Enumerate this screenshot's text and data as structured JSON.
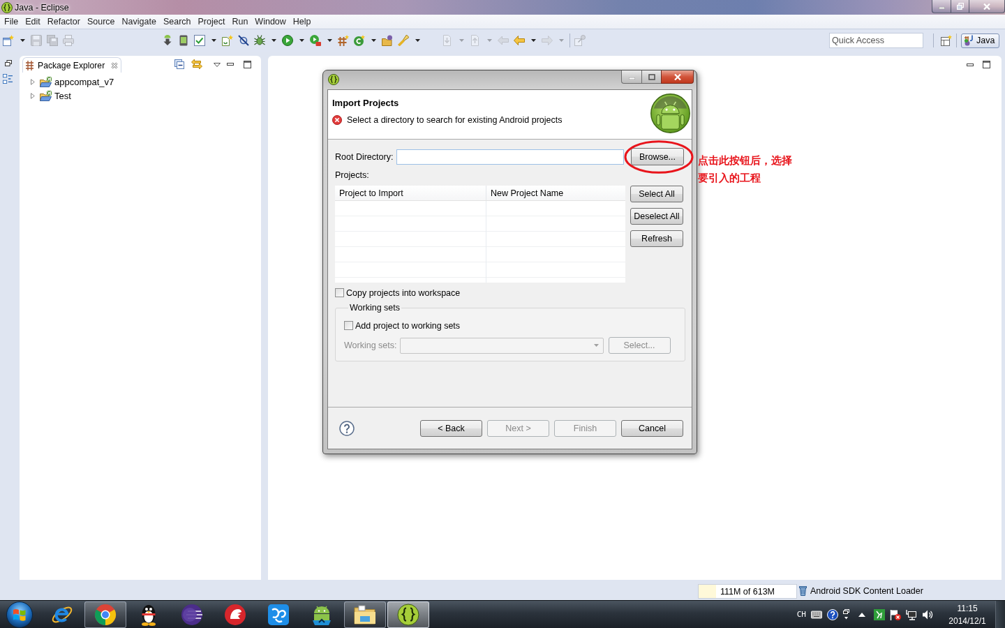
{
  "window": {
    "title": "Java - Eclipse"
  },
  "menu_bar": [
    "File",
    "Edit",
    "Refactor",
    "Source",
    "Navigate",
    "Search",
    "Project",
    "Run",
    "Window",
    "Help"
  ],
  "toolbar": {
    "groups": [
      [
        {
          "kind": "new-wizard",
          "disabled": false,
          "dropdown": true
        },
        {
          "kind": "save",
          "disabled": true,
          "dropdown": false
        },
        {
          "kind": "save-all",
          "disabled": true,
          "dropdown": false
        },
        {
          "kind": "print",
          "disabled": true,
          "dropdown": false
        }
      ],
      [
        {
          "kind": "sdk-download",
          "disabled": false,
          "dropdown": false
        },
        {
          "kind": "device",
          "disabled": false,
          "dropdown": false
        },
        {
          "kind": "check",
          "disabled": false,
          "dropdown": true
        },
        {
          "kind": "new-file",
          "disabled": false,
          "dropdown": false
        },
        {
          "kind": "strike",
          "disabled": false,
          "dropdown": false
        },
        {
          "kind": "bug",
          "disabled": false,
          "dropdown": true
        },
        {
          "kind": "run",
          "disabled": false,
          "dropdown": true
        },
        {
          "kind": "run-tool",
          "disabled": false,
          "dropdown": true
        },
        {
          "kind": "package",
          "disabled": false,
          "dropdown": false
        },
        {
          "kind": "new-class",
          "disabled": false,
          "dropdown": true
        },
        {
          "kind": "open-folder",
          "disabled": false,
          "dropdown": false
        },
        {
          "kind": "torch",
          "disabled": false,
          "dropdown": true
        }
      ],
      [
        {
          "kind": "next-mark",
          "disabled": true,
          "dropdown": true
        },
        {
          "kind": "prev-mark",
          "disabled": true,
          "dropdown": true
        },
        {
          "kind": "last-edit",
          "disabled": true,
          "dropdown": false
        },
        {
          "kind": "back",
          "disabled": false,
          "dropdown": true
        },
        {
          "kind": "forward",
          "disabled": true,
          "dropdown": true
        }
      ],
      [
        {
          "kind": "pin",
          "disabled": true,
          "dropdown": false
        }
      ]
    ],
    "quick_access": {
      "placeholder": "Quick Access"
    },
    "perspectives": [
      {
        "label": "Java",
        "selected": true
      }
    ]
  },
  "package_explorer": {
    "title": "Package Explorer",
    "items": [
      {
        "label": "appcompat_v7",
        "expanded": false
      },
      {
        "label": "Test",
        "expanded": false
      }
    ]
  },
  "dialog": {
    "title": "Import Projects",
    "message": {
      "error": true,
      "text": "Select a directory to search for existing Android projects"
    },
    "root_directory": {
      "label": "Root Directory:"
    },
    "browse_button": "Browse...",
    "projects_label": "Projects:",
    "projects_table": {
      "columns": [
        "Project to Import",
        "New Project Name"
      ]
    },
    "table_buttons": [
      "Select All",
      "Deselect All",
      "Refresh"
    ],
    "copy_into_workspace": {
      "label": "Copy projects into workspace",
      "checked": false
    },
    "working_sets": {
      "title": "Working sets",
      "add_to_working_sets": {
        "label": "Add project to working sets",
        "checked": false
      },
      "field_label": "Working sets:",
      "select_button": "Select...",
      "disabled": true
    },
    "footer_buttons": [
      {
        "label": "< Back",
        "disabled": false
      },
      {
        "label": "Next >",
        "disabled": true
      },
      {
        "label": "Finish",
        "disabled": true
      },
      {
        "label": "Cancel",
        "disabled": false
      }
    ]
  },
  "annotation": {
    "text": "点击此按钮后，选择要引入的工程"
  },
  "status_bar": {
    "heap": {
      "text": "111M of 613M",
      "level": 0.18
    },
    "job": "Android SDK Content Loader"
  },
  "taskbar": {
    "apps": [
      {
        "kind": "e-browser",
        "running": false,
        "selected": false
      },
      {
        "kind": "wheel-browser",
        "running": true,
        "selected": false
      },
      {
        "kind": "penguin",
        "running": false,
        "selected": false
      },
      {
        "kind": "sphere",
        "running": false,
        "selected": false
      },
      {
        "kind": "helmet",
        "running": false,
        "selected": false
      },
      {
        "kind": "tile",
        "running": false,
        "selected": false
      },
      {
        "kind": "robot",
        "running": false,
        "selected": false
      },
      {
        "kind": "folder",
        "running": true,
        "selected": false
      },
      {
        "kind": "braces-ball",
        "running": true,
        "selected": true
      }
    ],
    "tray": {
      "input_language": "CH",
      "time": "11:15",
      "date": "2014/12/1"
    }
  }
}
